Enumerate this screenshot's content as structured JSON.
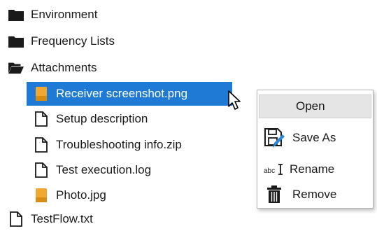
{
  "tree": {
    "items": [
      {
        "label": "Environment",
        "icon": "folder-icon"
      },
      {
        "label": "Frequency Lists",
        "icon": "folder-icon"
      },
      {
        "label": "Attachments",
        "icon": "folder-open-icon"
      },
      {
        "label": "Receiver screenshot.png",
        "icon": "image-file-icon",
        "selected": true
      },
      {
        "label": "Setup description",
        "icon": "document-icon"
      },
      {
        "label": "Troubleshooting info.zip",
        "icon": "document-icon"
      },
      {
        "label": "Test execution.log",
        "icon": "document-icon"
      },
      {
        "label": "Photo.jpg",
        "icon": "image-file-icon"
      },
      {
        "label": "TestFlow.txt",
        "icon": "document-icon"
      }
    ]
  },
  "context_menu": {
    "items": [
      {
        "label": "Open",
        "icon": ""
      },
      {
        "label": "Save As",
        "icon": "save-as-icon"
      },
      {
        "label": "Rename",
        "icon": "rename-icon"
      },
      {
        "label": "Remove",
        "icon": "trash-icon"
      }
    ]
  },
  "colors": {
    "selection": "#1f7ad6",
    "image_file_orange": "#f0a830",
    "folder": "#1a1a1a"
  }
}
